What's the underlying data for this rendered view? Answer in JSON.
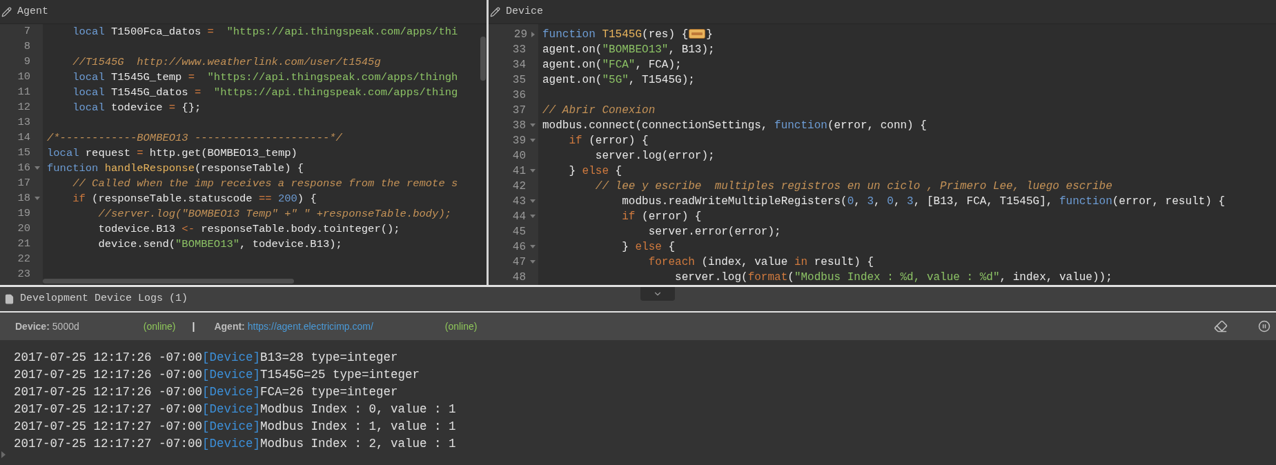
{
  "panels": [
    {
      "title": "Agent",
      "lines": [
        {
          "n": "7",
          "tokens": [
            {
              "kind": "kw",
              "text": "    local"
            },
            {
              "kind": "txt",
              "text": " T1500Fca_datos "
            },
            {
              "kind": "op",
              "text": "="
            },
            {
              "kind": "str",
              "text": "  \"https://api.thingspeak.com/apps/thi"
            }
          ]
        },
        {
          "n": "8"
        },
        {
          "n": "9",
          "tokens": [
            {
              "kind": "com",
              "text": "    //T1545G  http://www.weatherlink.com/user/t1545g"
            }
          ]
        },
        {
          "n": "10",
          "tokens": [
            {
              "kind": "kw",
              "text": "    local"
            },
            {
              "kind": "txt",
              "text": " T1545G_temp "
            },
            {
              "kind": "op",
              "text": "="
            },
            {
              "kind": "str",
              "text": "  \"https://api.thingspeak.com/apps/thingh"
            }
          ]
        },
        {
          "n": "11",
          "tokens": [
            {
              "kind": "kw",
              "text": "    local"
            },
            {
              "kind": "txt",
              "text": " T1545G_datos "
            },
            {
              "kind": "op",
              "text": "="
            },
            {
              "kind": "str",
              "text": "  \"https://api.thingspeak.com/apps/thing"
            }
          ]
        },
        {
          "n": "12",
          "tokens": [
            {
              "kind": "kw",
              "text": "    local"
            },
            {
              "kind": "txt",
              "text": " todevice "
            },
            {
              "kind": "op",
              "text": "="
            },
            {
              "kind": "txt",
              "text": " {};"
            }
          ]
        },
        {
          "n": "13"
        },
        {
          "n": "14",
          "tokens": [
            {
              "kind": "com",
              "text": "/*------------BOMBEO13 ---------------------*/"
            }
          ]
        },
        {
          "n": "15",
          "tokens": [
            {
              "kind": "kw",
              "text": "local"
            },
            {
              "kind": "txt",
              "text": " request "
            },
            {
              "kind": "op",
              "text": "="
            },
            {
              "kind": "txt",
              "text": " http.get(BOMBEO13_temp)"
            }
          ]
        },
        {
          "n": "16",
          "folded": false,
          "tokens": [
            {
              "kind": "kw",
              "text": "function"
            },
            {
              "kind": "fn",
              "text": " handleResponse"
            },
            {
              "kind": "txt",
              "text": "(responseTable) {"
            }
          ]
        },
        {
          "n": "17",
          "tokens": [
            {
              "kind": "com",
              "text": "    // Called when the imp receives a response from the remote s"
            }
          ]
        },
        {
          "n": "18",
          "folded": false,
          "tokens": [
            {
              "kind": "op",
              "text": "    if"
            },
            {
              "kind": "txt",
              "text": " (responseTable.statuscode "
            },
            {
              "kind": "op",
              "text": "=="
            },
            {
              "kind": "num",
              "text": " 200"
            },
            {
              "kind": "txt",
              "text": ") {"
            }
          ]
        },
        {
          "n": "19",
          "tokens": [
            {
              "kind": "com",
              "text": "        //server.log(\"BOMBEO13 Temp\" +\" \" +responseTable.body);"
            }
          ]
        },
        {
          "n": "20",
          "tokens": [
            {
              "kind": "txt",
              "text": "        todevice.B13 "
            },
            {
              "kind": "op",
              "text": "<-"
            },
            {
              "kind": "txt",
              "text": " responseTable.body.tointeger();"
            }
          ]
        },
        {
          "n": "21",
          "tokens": [
            {
              "kind": "txt",
              "text": "        device.send("
            },
            {
              "kind": "str",
              "text": "\"BOMBEO13\""
            },
            {
              "kind": "txt",
              "text": ", todevice.B13);"
            }
          ]
        },
        {
          "n": "22"
        },
        {
          "n": "23"
        }
      ]
    },
    {
      "title": "Device",
      "lines": [
        {
          "n": "29",
          "folded": true,
          "tokens": [
            {
              "kind": "kw",
              "text": "function"
            },
            {
              "kind": "fn",
              "text": " T1545G"
            },
            {
              "kind": "txt",
              "text": "(res) {"
            },
            {
              "kind": "folded"
            },
            {
              "kind": "txt",
              "text": "}"
            }
          ]
        },
        {
          "n": "33",
          "tokens": [
            {
              "kind": "txt",
              "text": "agent.on("
            },
            {
              "kind": "str",
              "text": "\"BOMBEO13\""
            },
            {
              "kind": "txt",
              "text": ", B13);"
            }
          ]
        },
        {
          "n": "34",
          "tokens": [
            {
              "kind": "txt",
              "text": "agent.on("
            },
            {
              "kind": "str",
              "text": "\"FCA\""
            },
            {
              "kind": "txt",
              "text": ", FCA);"
            }
          ]
        },
        {
          "n": "35",
          "tokens": [
            {
              "kind": "txt",
              "text": "agent.on("
            },
            {
              "kind": "str",
              "text": "\"5G\""
            },
            {
              "kind": "txt",
              "text": ", T1545G);"
            }
          ]
        },
        {
          "n": "36"
        },
        {
          "n": "37",
          "tokens": [
            {
              "kind": "com",
              "text": "// Abrir Conexion"
            }
          ]
        },
        {
          "n": "38",
          "folded": false,
          "tokens": [
            {
              "kind": "txt",
              "text": "modbus.connect(connectionSettings, "
            },
            {
              "kind": "kw",
              "text": "function"
            },
            {
              "kind": "txt",
              "text": "(error, conn) {"
            }
          ]
        },
        {
          "n": "39",
          "folded": false,
          "tokens": [
            {
              "kind": "op",
              "text": "    if"
            },
            {
              "kind": "txt",
              "text": " (error) {"
            }
          ]
        },
        {
          "n": "40",
          "tokens": [
            {
              "kind": "txt",
              "text": "        server.log(error);"
            }
          ]
        },
        {
          "n": "41",
          "folded": false,
          "tokens": [
            {
              "kind": "txt",
              "text": "    } "
            },
            {
              "kind": "op",
              "text": "else"
            },
            {
              "kind": "txt",
              "text": " {"
            }
          ]
        },
        {
          "n": "42",
          "tokens": [
            {
              "kind": "com",
              "text": "        // lee y escribe  multiples registros en un ciclo , Primero Lee, luego escribe"
            }
          ]
        },
        {
          "n": "43",
          "folded": false,
          "tokens": [
            {
              "kind": "txt",
              "text": "            modbus.readWriteMultipleRegisters("
            },
            {
              "kind": "num",
              "text": "0"
            },
            {
              "kind": "txt",
              "text": ", "
            },
            {
              "kind": "num",
              "text": "3"
            },
            {
              "kind": "txt",
              "text": ", "
            },
            {
              "kind": "num",
              "text": "0"
            },
            {
              "kind": "txt",
              "text": ", "
            },
            {
              "kind": "num",
              "text": "3"
            },
            {
              "kind": "txt",
              "text": ", [B13, FCA, T1545G], "
            },
            {
              "kind": "kw",
              "text": "function"
            },
            {
              "kind": "txt",
              "text": "(error, result) {"
            }
          ]
        },
        {
          "n": "44",
          "folded": false,
          "tokens": [
            {
              "kind": "op",
              "text": "            if"
            },
            {
              "kind": "txt",
              "text": " (error) {"
            }
          ]
        },
        {
          "n": "45",
          "tokens": [
            {
              "kind": "txt",
              "text": "                server.error(error);"
            }
          ]
        },
        {
          "n": "46",
          "folded": false,
          "tokens": [
            {
              "kind": "txt",
              "text": "            } "
            },
            {
              "kind": "op",
              "text": "else"
            },
            {
              "kind": "txt",
              "text": " {"
            }
          ]
        },
        {
          "n": "47",
          "folded": false,
          "tokens": [
            {
              "kind": "op",
              "text": "                foreach"
            },
            {
              "kind": "txt",
              "text": " (index, value "
            },
            {
              "kind": "op",
              "text": "in"
            },
            {
              "kind": "txt",
              "text": " result) {"
            }
          ]
        },
        {
          "n": "48",
          "tokens": [
            {
              "kind": "txt",
              "text": "                    server.log("
            },
            {
              "kind": "op",
              "text": "format"
            },
            {
              "kind": "txt",
              "text": "("
            },
            {
              "kind": "str",
              "text": "\"Modbus Index : %d, value : %d\""
            },
            {
              "kind": "txt",
              "text": ", index, value));"
            }
          ]
        }
      ]
    }
  ],
  "logs": {
    "title": "Development Device Logs (1)",
    "status": {
      "device_label": "Device:",
      "device_id": "5000d",
      "device_state": "(online)",
      "separator": "|",
      "agent_label": "Agent:",
      "agent_url": "https://agent.electricimp.com/",
      "agent_state": "(online)"
    },
    "entries": [
      {
        "time": "2017-07-25 12:17:26 -07:00",
        "source": "[Device]",
        "message": "B13=28 type=integer"
      },
      {
        "time": "2017-07-25 12:17:26 -07:00",
        "source": "[Device]",
        "message": "T1545G=25 type=integer"
      },
      {
        "time": "2017-07-25 12:17:26 -07:00",
        "source": "[Device]",
        "message": "FCA=26 type=integer"
      },
      {
        "time": "2017-07-25 12:17:27 -07:00",
        "source": "[Device]",
        "message": "Modbus Index : 0, value : 1"
      },
      {
        "time": "2017-07-25 12:17:27 -07:00",
        "source": "[Device]",
        "message": "Modbus Index : 1, value : 1"
      },
      {
        "time": "2017-07-25 12:17:27 -07:00",
        "source": "[Device]",
        "message": "Modbus Index : 2, value : 1"
      }
    ]
  }
}
